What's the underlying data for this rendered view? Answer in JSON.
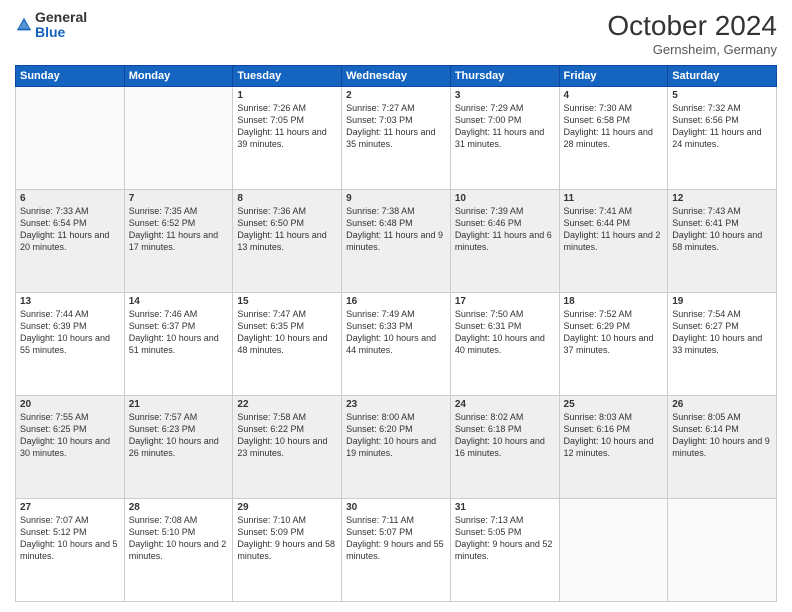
{
  "logo": {
    "general": "General",
    "blue": "Blue"
  },
  "header": {
    "month": "October 2024",
    "location": "Gernsheim, Germany"
  },
  "days_of_week": [
    "Sunday",
    "Monday",
    "Tuesday",
    "Wednesday",
    "Thursday",
    "Friday",
    "Saturday"
  ],
  "weeks": [
    [
      {
        "day": "",
        "sunrise": "",
        "sunset": "",
        "daylight": ""
      },
      {
        "day": "",
        "sunrise": "",
        "sunset": "",
        "daylight": ""
      },
      {
        "day": "1",
        "sunrise": "Sunrise: 7:26 AM",
        "sunset": "Sunset: 7:05 PM",
        "daylight": "Daylight: 11 hours and 39 minutes."
      },
      {
        "day": "2",
        "sunrise": "Sunrise: 7:27 AM",
        "sunset": "Sunset: 7:03 PM",
        "daylight": "Daylight: 11 hours and 35 minutes."
      },
      {
        "day": "3",
        "sunrise": "Sunrise: 7:29 AM",
        "sunset": "Sunset: 7:00 PM",
        "daylight": "Daylight: 11 hours and 31 minutes."
      },
      {
        "day": "4",
        "sunrise": "Sunrise: 7:30 AM",
        "sunset": "Sunset: 6:58 PM",
        "daylight": "Daylight: 11 hours and 28 minutes."
      },
      {
        "day": "5",
        "sunrise": "Sunrise: 7:32 AM",
        "sunset": "Sunset: 6:56 PM",
        "daylight": "Daylight: 11 hours and 24 minutes."
      }
    ],
    [
      {
        "day": "6",
        "sunrise": "Sunrise: 7:33 AM",
        "sunset": "Sunset: 6:54 PM",
        "daylight": "Daylight: 11 hours and 20 minutes."
      },
      {
        "day": "7",
        "sunrise": "Sunrise: 7:35 AM",
        "sunset": "Sunset: 6:52 PM",
        "daylight": "Daylight: 11 hours and 17 minutes."
      },
      {
        "day": "8",
        "sunrise": "Sunrise: 7:36 AM",
        "sunset": "Sunset: 6:50 PM",
        "daylight": "Daylight: 11 hours and 13 minutes."
      },
      {
        "day": "9",
        "sunrise": "Sunrise: 7:38 AM",
        "sunset": "Sunset: 6:48 PM",
        "daylight": "Daylight: 11 hours and 9 minutes."
      },
      {
        "day": "10",
        "sunrise": "Sunrise: 7:39 AM",
        "sunset": "Sunset: 6:46 PM",
        "daylight": "Daylight: 11 hours and 6 minutes."
      },
      {
        "day": "11",
        "sunrise": "Sunrise: 7:41 AM",
        "sunset": "Sunset: 6:44 PM",
        "daylight": "Daylight: 11 hours and 2 minutes."
      },
      {
        "day": "12",
        "sunrise": "Sunrise: 7:43 AM",
        "sunset": "Sunset: 6:41 PM",
        "daylight": "Daylight: 10 hours and 58 minutes."
      }
    ],
    [
      {
        "day": "13",
        "sunrise": "Sunrise: 7:44 AM",
        "sunset": "Sunset: 6:39 PM",
        "daylight": "Daylight: 10 hours and 55 minutes."
      },
      {
        "day": "14",
        "sunrise": "Sunrise: 7:46 AM",
        "sunset": "Sunset: 6:37 PM",
        "daylight": "Daylight: 10 hours and 51 minutes."
      },
      {
        "day": "15",
        "sunrise": "Sunrise: 7:47 AM",
        "sunset": "Sunset: 6:35 PM",
        "daylight": "Daylight: 10 hours and 48 minutes."
      },
      {
        "day": "16",
        "sunrise": "Sunrise: 7:49 AM",
        "sunset": "Sunset: 6:33 PM",
        "daylight": "Daylight: 10 hours and 44 minutes."
      },
      {
        "day": "17",
        "sunrise": "Sunrise: 7:50 AM",
        "sunset": "Sunset: 6:31 PM",
        "daylight": "Daylight: 10 hours and 40 minutes."
      },
      {
        "day": "18",
        "sunrise": "Sunrise: 7:52 AM",
        "sunset": "Sunset: 6:29 PM",
        "daylight": "Daylight: 10 hours and 37 minutes."
      },
      {
        "day": "19",
        "sunrise": "Sunrise: 7:54 AM",
        "sunset": "Sunset: 6:27 PM",
        "daylight": "Daylight: 10 hours and 33 minutes."
      }
    ],
    [
      {
        "day": "20",
        "sunrise": "Sunrise: 7:55 AM",
        "sunset": "Sunset: 6:25 PM",
        "daylight": "Daylight: 10 hours and 30 minutes."
      },
      {
        "day": "21",
        "sunrise": "Sunrise: 7:57 AM",
        "sunset": "Sunset: 6:23 PM",
        "daylight": "Daylight: 10 hours and 26 minutes."
      },
      {
        "day": "22",
        "sunrise": "Sunrise: 7:58 AM",
        "sunset": "Sunset: 6:22 PM",
        "daylight": "Daylight: 10 hours and 23 minutes."
      },
      {
        "day": "23",
        "sunrise": "Sunrise: 8:00 AM",
        "sunset": "Sunset: 6:20 PM",
        "daylight": "Daylight: 10 hours and 19 minutes."
      },
      {
        "day": "24",
        "sunrise": "Sunrise: 8:02 AM",
        "sunset": "Sunset: 6:18 PM",
        "daylight": "Daylight: 10 hours and 16 minutes."
      },
      {
        "day": "25",
        "sunrise": "Sunrise: 8:03 AM",
        "sunset": "Sunset: 6:16 PM",
        "daylight": "Daylight: 10 hours and 12 minutes."
      },
      {
        "day": "26",
        "sunrise": "Sunrise: 8:05 AM",
        "sunset": "Sunset: 6:14 PM",
        "daylight": "Daylight: 10 hours and 9 minutes."
      }
    ],
    [
      {
        "day": "27",
        "sunrise": "Sunrise: 7:07 AM",
        "sunset": "Sunset: 5:12 PM",
        "daylight": "Daylight: 10 hours and 5 minutes."
      },
      {
        "day": "28",
        "sunrise": "Sunrise: 7:08 AM",
        "sunset": "Sunset: 5:10 PM",
        "daylight": "Daylight: 10 hours and 2 minutes."
      },
      {
        "day": "29",
        "sunrise": "Sunrise: 7:10 AM",
        "sunset": "Sunset: 5:09 PM",
        "daylight": "Daylight: 9 hours and 58 minutes."
      },
      {
        "day": "30",
        "sunrise": "Sunrise: 7:11 AM",
        "sunset": "Sunset: 5:07 PM",
        "daylight": "Daylight: 9 hours and 55 minutes."
      },
      {
        "day": "31",
        "sunrise": "Sunrise: 7:13 AM",
        "sunset": "Sunset: 5:05 PM",
        "daylight": "Daylight: 9 hours and 52 minutes."
      },
      {
        "day": "",
        "sunrise": "",
        "sunset": "",
        "daylight": ""
      },
      {
        "day": "",
        "sunrise": "",
        "sunset": "",
        "daylight": ""
      }
    ]
  ]
}
